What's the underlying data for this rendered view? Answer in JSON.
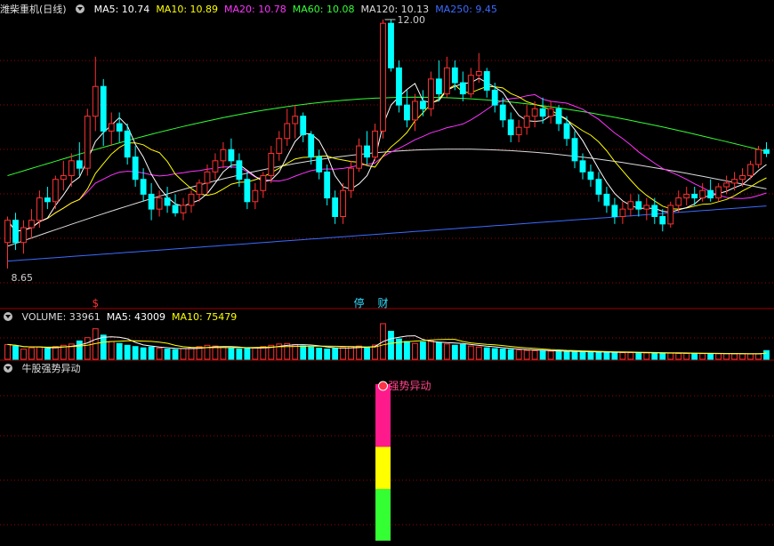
{
  "price_panel": {
    "title": "潍柴重机(日线)",
    "ma_labels": [
      {
        "text": "MA5: 10.74",
        "color": "#ffffff"
      },
      {
        "text": "MA10: 10.89",
        "color": "#ffff00"
      },
      {
        "text": "MA20: 10.78",
        "color": "#ff33ff"
      },
      {
        "text": "MA60: 10.08",
        "color": "#33ff33"
      },
      {
        "text": "MA120: 10.13",
        "color": "#dcdcdc"
      },
      {
        "text": "MA250: 9.45",
        "color": "#3b6bff"
      }
    ],
    "high_label": "12.00",
    "low_label": "8.65",
    "markers": [
      {
        "text": "$",
        "color": "#ff3030",
        "index": 11
      },
      {
        "text": "停",
        "color": "#33ddff",
        "index": 44
      },
      {
        "text": "财",
        "color": "#33ddff",
        "index": 47
      }
    ]
  },
  "volume_panel": {
    "labels": [
      {
        "text": "VOLUME: 33961",
        "color": "#dcdcdc"
      },
      {
        "text": "MA5: 43009",
        "color": "#ffffff"
      },
      {
        "text": "MA10: 75479",
        "color": "#ffff00"
      }
    ]
  },
  "indicator_panel": {
    "title": "牛股强势异动",
    "signal_label": "强势异动"
  },
  "colors": {
    "up": "#ff3232",
    "down": "#00ffff",
    "grid": "#a00000",
    "ma5": "#ffffff",
    "ma10": "#ffff00",
    "ma20": "#ff33ff",
    "ma60": "#33ff33",
    "ma120": "#dcdcdc",
    "ma250": "#3b6bff",
    "signal_top": "#ff1a8c",
    "signal_mid": "#ffff00",
    "signal_bot": "#33ff33"
  },
  "chart_data": {
    "type": "candlestick",
    "price_range": [
      8.65,
      12.0
    ],
    "candles": [
      {
        "o": 9.0,
        "h": 9.35,
        "l": 8.65,
        "c": 9.3
      },
      {
        "o": 9.3,
        "h": 9.4,
        "l": 8.9,
        "c": 9.0
      },
      {
        "o": 9.0,
        "h": 9.3,
        "l": 8.85,
        "c": 9.2
      },
      {
        "o": 9.2,
        "h": 9.45,
        "l": 9.05,
        "c": 9.3
      },
      {
        "o": 9.3,
        "h": 9.7,
        "l": 9.2,
        "c": 9.6
      },
      {
        "o": 9.6,
        "h": 9.75,
        "l": 9.45,
        "c": 9.55
      },
      {
        "o": 9.55,
        "h": 9.9,
        "l": 9.45,
        "c": 9.85
      },
      {
        "o": 9.85,
        "h": 10.1,
        "l": 9.7,
        "c": 9.9
      },
      {
        "o": 9.9,
        "h": 10.2,
        "l": 9.75,
        "c": 10.1
      },
      {
        "o": 10.1,
        "h": 10.35,
        "l": 9.9,
        "c": 10.0
      },
      {
        "o": 10.0,
        "h": 10.8,
        "l": 9.9,
        "c": 10.7
      },
      {
        "o": 10.7,
        "h": 11.5,
        "l": 10.5,
        "c": 11.1
      },
      {
        "o": 11.1,
        "h": 11.2,
        "l": 10.3,
        "c": 10.5
      },
      {
        "o": 10.5,
        "h": 10.75,
        "l": 10.3,
        "c": 10.6
      },
      {
        "o": 10.6,
        "h": 10.75,
        "l": 10.35,
        "c": 10.5
      },
      {
        "o": 10.5,
        "h": 10.6,
        "l": 10.05,
        "c": 10.15
      },
      {
        "o": 10.15,
        "h": 10.3,
        "l": 9.75,
        "c": 9.85
      },
      {
        "o": 9.85,
        "h": 10.0,
        "l": 9.55,
        "c": 9.65
      },
      {
        "o": 9.65,
        "h": 9.8,
        "l": 9.3,
        "c": 9.45
      },
      {
        "o": 9.45,
        "h": 9.7,
        "l": 9.35,
        "c": 9.6
      },
      {
        "o": 9.6,
        "h": 9.75,
        "l": 9.4,
        "c": 9.5
      },
      {
        "o": 9.5,
        "h": 9.65,
        "l": 9.35,
        "c": 9.4
      },
      {
        "o": 9.4,
        "h": 9.6,
        "l": 9.3,
        "c": 9.5
      },
      {
        "o": 9.5,
        "h": 9.7,
        "l": 9.4,
        "c": 9.65
      },
      {
        "o": 9.65,
        "h": 9.85,
        "l": 9.55,
        "c": 9.8
      },
      {
        "o": 9.8,
        "h": 10.05,
        "l": 9.65,
        "c": 9.95
      },
      {
        "o": 9.95,
        "h": 10.2,
        "l": 9.85,
        "c": 10.1
      },
      {
        "o": 10.1,
        "h": 10.35,
        "l": 10.0,
        "c": 10.25
      },
      {
        "o": 10.25,
        "h": 10.4,
        "l": 10.0,
        "c": 10.1
      },
      {
        "o": 10.1,
        "h": 10.2,
        "l": 9.75,
        "c": 9.85
      },
      {
        "o": 9.85,
        "h": 9.95,
        "l": 9.45,
        "c": 9.55
      },
      {
        "o": 9.55,
        "h": 9.8,
        "l": 9.45,
        "c": 9.7
      },
      {
        "o": 9.7,
        "h": 9.95,
        "l": 9.6,
        "c": 9.9
      },
      {
        "o": 9.9,
        "h": 10.3,
        "l": 9.8,
        "c": 10.2
      },
      {
        "o": 10.2,
        "h": 10.5,
        "l": 10.1,
        "c": 10.4
      },
      {
        "o": 10.4,
        "h": 10.8,
        "l": 10.3,
        "c": 10.6
      },
      {
        "o": 10.6,
        "h": 10.85,
        "l": 10.4,
        "c": 10.7
      },
      {
        "o": 10.7,
        "h": 10.75,
        "l": 10.35,
        "c": 10.45
      },
      {
        "o": 10.45,
        "h": 10.5,
        "l": 10.05,
        "c": 10.15
      },
      {
        "o": 10.15,
        "h": 10.25,
        "l": 9.85,
        "c": 9.95
      },
      {
        "o": 9.95,
        "h": 10.05,
        "l": 9.5,
        "c": 9.6
      },
      {
        "o": 9.6,
        "h": 9.7,
        "l": 9.25,
        "c": 9.35
      },
      {
        "o": 9.35,
        "h": 9.8,
        "l": 9.25,
        "c": 9.7
      },
      {
        "o": 9.7,
        "h": 10.1,
        "l": 9.6,
        "c": 10.0
      },
      {
        "o": 10.0,
        "h": 10.4,
        "l": 9.95,
        "c": 10.3
      },
      {
        "o": 10.3,
        "h": 10.5,
        "l": 10.05,
        "c": 10.15
      },
      {
        "o": 10.15,
        "h": 10.6,
        "l": 10.1,
        "c": 10.5
      },
      {
        "o": 10.5,
        "h": 12.0,
        "l": 10.4,
        "c": 11.95
      },
      {
        "o": 11.95,
        "h": 12.0,
        "l": 11.3,
        "c": 11.35
      },
      {
        "o": 11.35,
        "h": 11.45,
        "l": 10.75,
        "c": 10.85
      },
      {
        "o": 10.85,
        "h": 11.05,
        "l": 10.55,
        "c": 10.65
      },
      {
        "o": 10.65,
        "h": 11.0,
        "l": 10.5,
        "c": 10.9
      },
      {
        "o": 10.9,
        "h": 11.05,
        "l": 10.7,
        "c": 10.8
      },
      {
        "o": 10.8,
        "h": 11.3,
        "l": 10.7,
        "c": 11.2
      },
      {
        "o": 11.2,
        "h": 11.45,
        "l": 10.9,
        "c": 11.0
      },
      {
        "o": 11.0,
        "h": 11.5,
        "l": 10.95,
        "c": 11.35
      },
      {
        "o": 11.35,
        "h": 11.45,
        "l": 11.05,
        "c": 11.15
      },
      {
        "o": 11.15,
        "h": 11.3,
        "l": 10.9,
        "c": 11.0
      },
      {
        "o": 11.0,
        "h": 11.35,
        "l": 10.95,
        "c": 11.25
      },
      {
        "o": 11.25,
        "h": 11.55,
        "l": 11.15,
        "c": 11.3
      },
      {
        "o": 11.3,
        "h": 11.35,
        "l": 10.95,
        "c": 11.05
      },
      {
        "o": 11.05,
        "h": 11.15,
        "l": 10.75,
        "c": 10.85
      },
      {
        "o": 10.85,
        "h": 10.95,
        "l": 10.55,
        "c": 10.65
      },
      {
        "o": 10.65,
        "h": 10.75,
        "l": 10.35,
        "c": 10.45
      },
      {
        "o": 10.45,
        "h": 10.65,
        "l": 10.35,
        "c": 10.55
      },
      {
        "o": 10.55,
        "h": 10.85,
        "l": 10.45,
        "c": 10.7
      },
      {
        "o": 10.7,
        "h": 10.9,
        "l": 10.55,
        "c": 10.8
      },
      {
        "o": 10.8,
        "h": 10.95,
        "l": 10.6,
        "c": 10.7
      },
      {
        "o": 10.7,
        "h": 10.9,
        "l": 10.6,
        "c": 10.8
      },
      {
        "o": 10.8,
        "h": 10.85,
        "l": 10.5,
        "c": 10.6
      },
      {
        "o": 10.6,
        "h": 10.7,
        "l": 10.3,
        "c": 10.4
      },
      {
        "o": 10.4,
        "h": 10.5,
        "l": 10.0,
        "c": 10.1
      },
      {
        "o": 10.1,
        "h": 10.2,
        "l": 9.85,
        "c": 9.95
      },
      {
        "o": 9.95,
        "h": 10.05,
        "l": 9.75,
        "c": 9.85
      },
      {
        "o": 9.85,
        "h": 9.95,
        "l": 9.55,
        "c": 9.65
      },
      {
        "o": 9.65,
        "h": 9.75,
        "l": 9.4,
        "c": 9.5
      },
      {
        "o": 9.5,
        "h": 9.6,
        "l": 9.25,
        "c": 9.35
      },
      {
        "o": 9.35,
        "h": 9.55,
        "l": 9.25,
        "c": 9.45
      },
      {
        "o": 9.45,
        "h": 9.65,
        "l": 9.35,
        "c": 9.55
      },
      {
        "o": 9.55,
        "h": 9.65,
        "l": 9.35,
        "c": 9.45
      },
      {
        "o": 9.45,
        "h": 9.6,
        "l": 9.3,
        "c": 9.5
      },
      {
        "o": 9.5,
        "h": 9.6,
        "l": 9.25,
        "c": 9.35
      },
      {
        "o": 9.35,
        "h": 9.45,
        "l": 9.15,
        "c": 9.25
      },
      {
        "o": 9.25,
        "h": 9.55,
        "l": 9.2,
        "c": 9.5
      },
      {
        "o": 9.5,
        "h": 9.7,
        "l": 9.4,
        "c": 9.6
      },
      {
        "o": 9.6,
        "h": 9.75,
        "l": 9.5,
        "c": 9.65
      },
      {
        "o": 9.65,
        "h": 9.75,
        "l": 9.5,
        "c": 9.6
      },
      {
        "o": 9.6,
        "h": 9.8,
        "l": 9.55,
        "c": 9.7
      },
      {
        "o": 9.7,
        "h": 9.85,
        "l": 9.55,
        "c": 9.6
      },
      {
        "o": 9.6,
        "h": 9.8,
        "l": 9.55,
        "c": 9.75
      },
      {
        "o": 9.75,
        "h": 9.9,
        "l": 9.65,
        "c": 9.8
      },
      {
        "o": 9.8,
        "h": 9.95,
        "l": 9.7,
        "c": 9.85
      },
      {
        "o": 9.85,
        "h": 10.0,
        "l": 9.75,
        "c": 9.9
      },
      {
        "o": 9.9,
        "h": 10.1,
        "l": 9.85,
        "c": 10.05
      },
      {
        "o": 10.05,
        "h": 10.3,
        "l": 10.0,
        "c": 10.25
      },
      {
        "o": 10.25,
        "h": 10.35,
        "l": 10.15,
        "c": 10.2
      }
    ],
    "volume": [
      58,
      52,
      40,
      45,
      48,
      42,
      50,
      55,
      60,
      72,
      85,
      120,
      95,
      70,
      62,
      55,
      50,
      45,
      48,
      44,
      40,
      38,
      42,
      46,
      50,
      55,
      52,
      48,
      44,
      40,
      42,
      46,
      50,
      55,
      60,
      62,
      58,
      52,
      48,
      44,
      40,
      42,
      46,
      50,
      52,
      48,
      56,
      140,
      110,
      80,
      70,
      62,
      68,
      72,
      66,
      60,
      55,
      58,
      52,
      48,
      45,
      42,
      40,
      38,
      36,
      35,
      34,
      33,
      32,
      31,
      30,
      30,
      29,
      28,
      28,
      27,
      27,
      26,
      26,
      25,
      25,
      24,
      24,
      24,
      23,
      23,
      23,
      22,
      22,
      22,
      22,
      21,
      21,
      21,
      21,
      34
    ],
    "signal": {
      "index": 47,
      "value_range": [
        0,
        1
      ],
      "segments": [
        {
          "color": "signal_bot",
          "from": 0,
          "to": 0.33
        },
        {
          "color": "signal_mid",
          "from": 0.33,
          "to": 0.6
        },
        {
          "color": "signal_top",
          "from": 0.6,
          "to": 1
        }
      ]
    }
  }
}
